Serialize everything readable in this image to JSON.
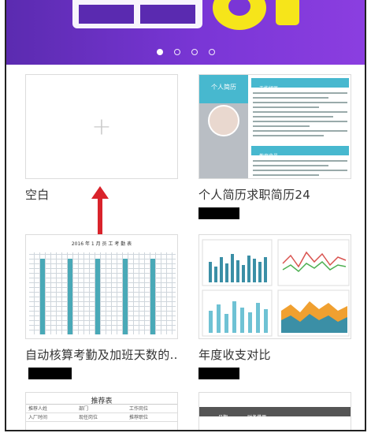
{
  "banner": {
    "dots": [
      true,
      false,
      false,
      false
    ]
  },
  "templates": [
    {
      "title": "空白"
    },
    {
      "title": "个人简历求职简历24",
      "resume": {
        "name": "个人简历",
        "sec1": "工作经历",
        "sec2": "教育背景"
      }
    },
    {
      "title": "自动核算考勤及加班天数的...",
      "sheet_title": "2016 年 1 月 员 工 考 勤 表"
    },
    {
      "title": "年度收支对比"
    }
  ],
  "bottom_templates": [
    {
      "title": "推荐表",
      "row1": [
        "推荐人姓",
        "部门",
        "工作岗位"
      ],
      "row2": [
        "入厂时间",
        "现任岗位",
        "推荐职位"
      ]
    },
    {
      "header": "财务借用",
      "row1": [
        "日期"
      ]
    }
  ],
  "colors": {
    "banner": "#7a36d6",
    "accent": "#47b8cf",
    "arrow": "#d9232b"
  }
}
